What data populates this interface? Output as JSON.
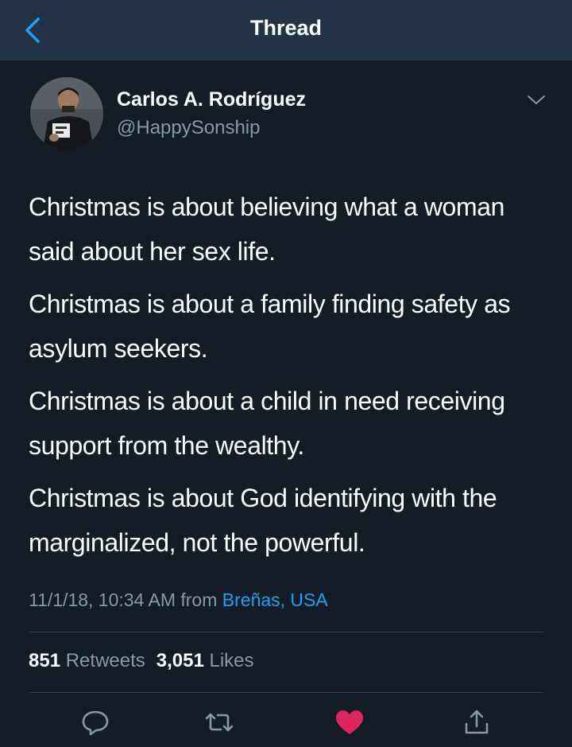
{
  "header": {
    "title": "Thread"
  },
  "tweet": {
    "author_name": "Carlos A. Rodríguez",
    "author_handle": "@HappySonship",
    "paragraphs": [
      "Christmas is about believing what a woman said about her sex life.",
      "Christmas is about a family finding safety as asylum seekers.",
      "Christmas is about a child in need receiving support from the wealthy.",
      "Christmas is about God identifying with the marginalized, not the powerful."
    ],
    "timestamp": "11/1/18, 10:34 AM from ",
    "location": "Breñas, USA",
    "retweets_count": "851",
    "retweets_label": "Retweets",
    "likes_count": "3,051",
    "likes_label": "Likes"
  },
  "colors": {
    "background": "#141d26",
    "header": "#243447",
    "muted": "#8899a6",
    "link": "#1da1f2",
    "like": "#e0245e"
  },
  "icons": [
    "back-arrow-icon",
    "chevron-down-icon",
    "reply-icon",
    "retweet-icon",
    "heart-icon",
    "share-icon"
  ]
}
